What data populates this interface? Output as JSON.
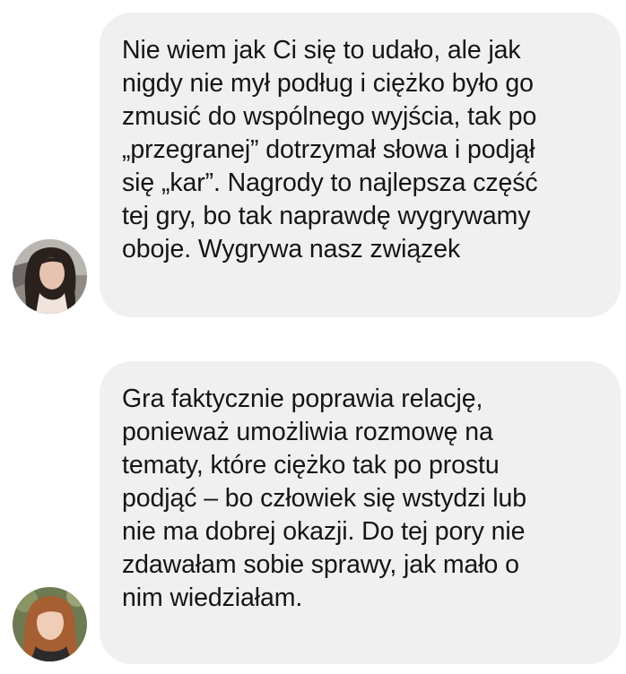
{
  "colors": {
    "bubble_background": "#f0f0f0",
    "text": "#151515",
    "page_background": "#ffffff"
  },
  "messages": [
    {
      "avatar_icon": "user-avatar-icon",
      "text": "Nie wiem jak Ci się to udało, ale jak\nnigdy nie mył podług i ciężko było go\nzmusić do wspólnego wyjścia, tak po\n„przegranej” dotrzymał słowa i podjął\nsię „kar”. Nagrody to najlepsza część\ntej gry, bo tak naprawdę wygrywamy\noboje. Wygrywa nasz związek"
    },
    {
      "avatar_icon": "user-avatar-icon",
      "text": "Gra faktycznie poprawia relację,\nponieważ umożliwia rozmowę na\ntematy, które ciężko tak po prostu\npodjąć – bo człowiek się wstydzi lub\nnie ma dobrej okazji. Do tej pory nie\nzdawałam sobie sprawy, jak mało o\nnim wiedziałam."
    }
  ]
}
